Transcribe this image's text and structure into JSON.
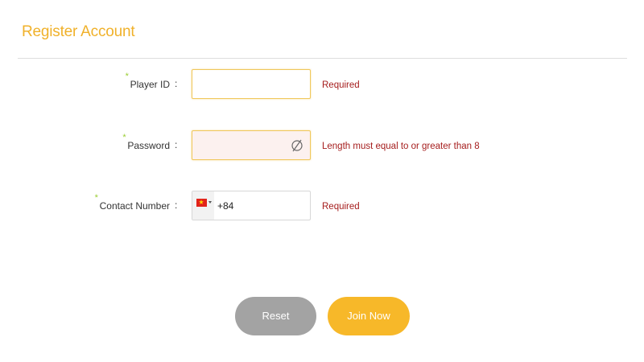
{
  "header": {
    "title": "Register Account"
  },
  "form": {
    "required_mark": "*",
    "colon": ":",
    "fields": [
      {
        "label": "Player ID",
        "value": "",
        "error": "Required"
      },
      {
        "label": "Password",
        "value": "",
        "error": "Length must equal to or greater than 8",
        "icon": "eye-off-icon"
      },
      {
        "label": "Contact Number",
        "dial_code": "+84",
        "country_flag": "vietnam-flag-icon",
        "error": "Required"
      }
    ]
  },
  "actions": {
    "reset_label": "Reset",
    "join_label": "Join Now"
  },
  "colors": {
    "accent": "#f0b12a",
    "error": "#a51d1d",
    "reset_button": "#a3a3a3",
    "join_button": "#f7b829"
  }
}
